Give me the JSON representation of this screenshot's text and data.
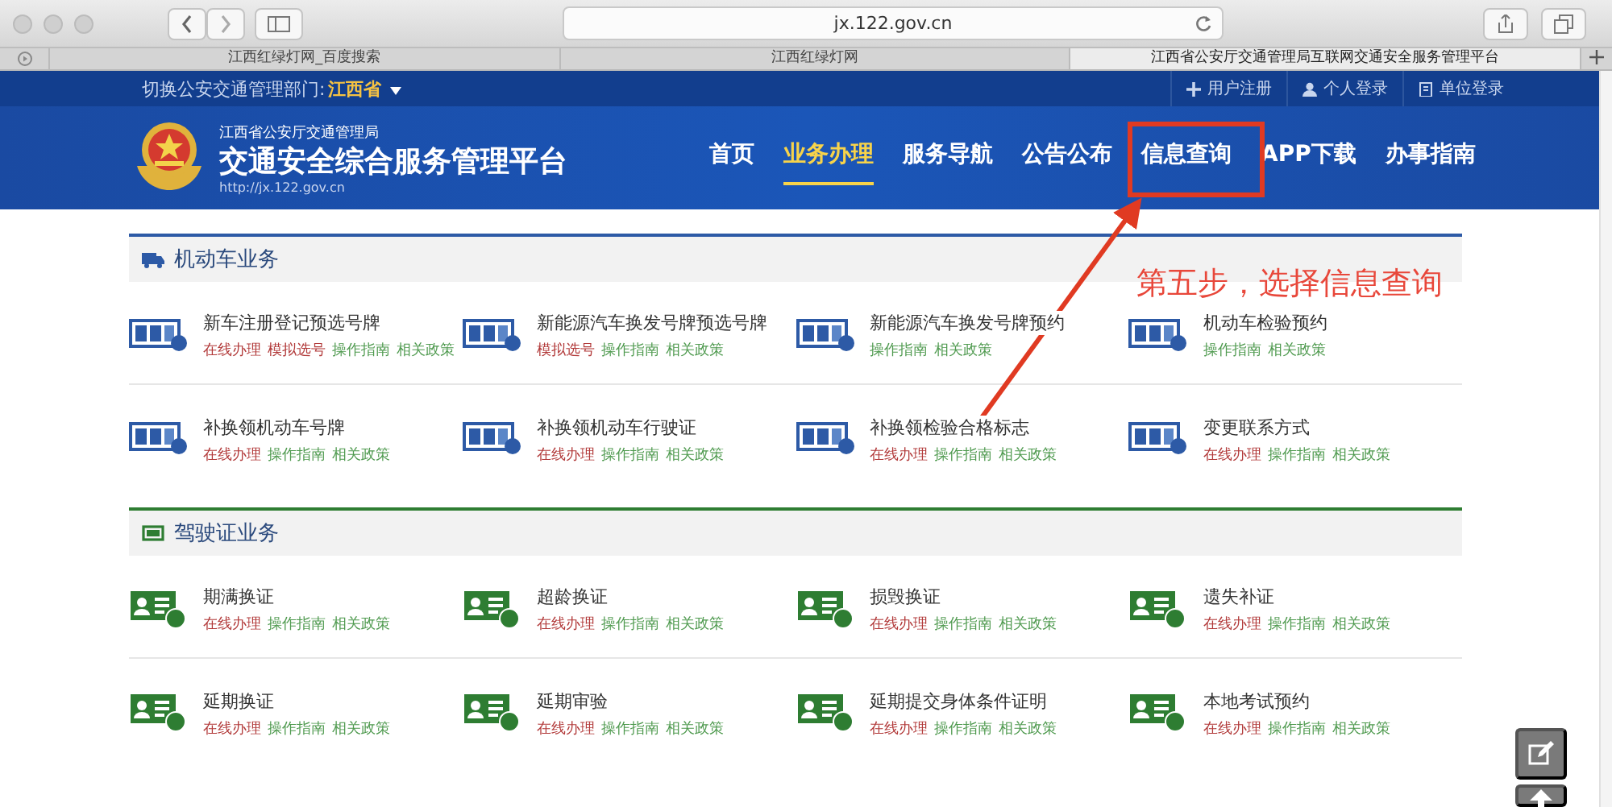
{
  "browser": {
    "url": "jx.122.gov.cn",
    "tabs": [
      {
        "title": "江西红绿灯网_百度搜索",
        "selected": false
      },
      {
        "title": "江西红绿灯网",
        "selected": false
      },
      {
        "title": "江西省公安厅交通管理局互联网交通安全服务管理平台",
        "selected": true
      }
    ]
  },
  "header": {
    "region_label": "切换公安交通管理部门:",
    "region": "江西省",
    "user_links": [
      {
        "label": "用户注册",
        "kind": "register"
      },
      {
        "label": "个人登录",
        "kind": "person"
      },
      {
        "label": "单位登录",
        "kind": "unit"
      }
    ],
    "org": "江西省公安厅交通管理局",
    "title": "交通安全综合服务管理平台",
    "site_url": "http://jx.122.gov.cn",
    "nav": [
      {
        "label": "首页",
        "selected": false
      },
      {
        "label": "业务办理",
        "selected": true
      },
      {
        "label": "服务导航",
        "selected": false
      },
      {
        "label": "公告公布",
        "selected": false
      },
      {
        "label": "信息查询",
        "selected": false
      },
      {
        "label": "APP下载",
        "selected": false
      },
      {
        "label": "办事指南",
        "selected": false
      }
    ]
  },
  "sections": [
    {
      "title": "机动车业务",
      "kind": "vehicle",
      "color": "#2d5aa6",
      "items": [
        {
          "title": "新车注册登记预选号牌",
          "links": [
            {
              "label": "在线办理",
              "kind": "action"
            },
            {
              "label": "模拟选号",
              "kind": "action"
            },
            {
              "label": "操作指南",
              "kind": "info"
            },
            {
              "label": "相关政策",
              "kind": "info"
            }
          ]
        },
        {
          "title": "新能源汽车换发号牌预选号牌",
          "links": [
            {
              "label": "模拟选号",
              "kind": "action"
            },
            {
              "label": "操作指南",
              "kind": "info"
            },
            {
              "label": "相关政策",
              "kind": "info"
            }
          ]
        },
        {
          "title": "新能源汽车换发号牌预约",
          "links": [
            {
              "label": "操作指南",
              "kind": "info"
            },
            {
              "label": "相关政策",
              "kind": "info"
            }
          ]
        },
        {
          "title": "机动车检验预约",
          "links": [
            {
              "label": "操作指南",
              "kind": "info"
            },
            {
              "label": "相关政策",
              "kind": "info"
            }
          ]
        },
        {
          "title": "补换领机动车号牌",
          "links": [
            {
              "label": "在线办理",
              "kind": "action"
            },
            {
              "label": "操作指南",
              "kind": "info"
            },
            {
              "label": "相关政策",
              "kind": "info"
            }
          ]
        },
        {
          "title": "补换领机动车行驶证",
          "links": [
            {
              "label": "在线办理",
              "kind": "action"
            },
            {
              "label": "操作指南",
              "kind": "info"
            },
            {
              "label": "相关政策",
              "kind": "info"
            }
          ]
        },
        {
          "title": "补换领检验合格标志",
          "links": [
            {
              "label": "在线办理",
              "kind": "action"
            },
            {
              "label": "操作指南",
              "kind": "info"
            },
            {
              "label": "相关政策",
              "kind": "info"
            }
          ]
        },
        {
          "title": "变更联系方式",
          "links": [
            {
              "label": "在线办理",
              "kind": "action"
            },
            {
              "label": "操作指南",
              "kind": "info"
            },
            {
              "label": "相关政策",
              "kind": "info"
            }
          ]
        }
      ]
    },
    {
      "title": "驾驶证业务",
      "kind": "license",
      "color": "#2e7d32",
      "items": [
        {
          "title": "期满换证",
          "links": [
            {
              "label": "在线办理",
              "kind": "action"
            },
            {
              "label": "操作指南",
              "kind": "info"
            },
            {
              "label": "相关政策",
              "kind": "info"
            }
          ]
        },
        {
          "title": "超龄换证",
          "links": [
            {
              "label": "在线办理",
              "kind": "action"
            },
            {
              "label": "操作指南",
              "kind": "info"
            },
            {
              "label": "相关政策",
              "kind": "info"
            }
          ]
        },
        {
          "title": "损毁换证",
          "links": [
            {
              "label": "在线办理",
              "kind": "action"
            },
            {
              "label": "操作指南",
              "kind": "info"
            },
            {
              "label": "相关政策",
              "kind": "info"
            }
          ]
        },
        {
          "title": "遗失补证",
          "links": [
            {
              "label": "在线办理",
              "kind": "action"
            },
            {
              "label": "操作指南",
              "kind": "info"
            },
            {
              "label": "相关政策",
              "kind": "info"
            }
          ]
        },
        {
          "title": "延期换证",
          "links": [
            {
              "label": "在线办理",
              "kind": "action"
            },
            {
              "label": "操作指南",
              "kind": "info"
            },
            {
              "label": "相关政策",
              "kind": "info"
            }
          ]
        },
        {
          "title": "延期审验",
          "links": [
            {
              "label": "在线办理",
              "kind": "action"
            },
            {
              "label": "操作指南",
              "kind": "info"
            },
            {
              "label": "相关政策",
              "kind": "info"
            }
          ]
        },
        {
          "title": "延期提交身体条件证明",
          "links": [
            {
              "label": "在线办理",
              "kind": "action"
            },
            {
              "label": "操作指南",
              "kind": "info"
            },
            {
              "label": "相关政策",
              "kind": "info"
            }
          ]
        },
        {
          "title": "本地考试预约",
          "links": [
            {
              "label": "在线办理",
              "kind": "action"
            },
            {
              "label": "操作指南",
              "kind": "info"
            },
            {
              "label": "相关政策",
              "kind": "info"
            }
          ]
        }
      ]
    }
  ],
  "annotation": {
    "text": "第五步，选择信息查询"
  }
}
